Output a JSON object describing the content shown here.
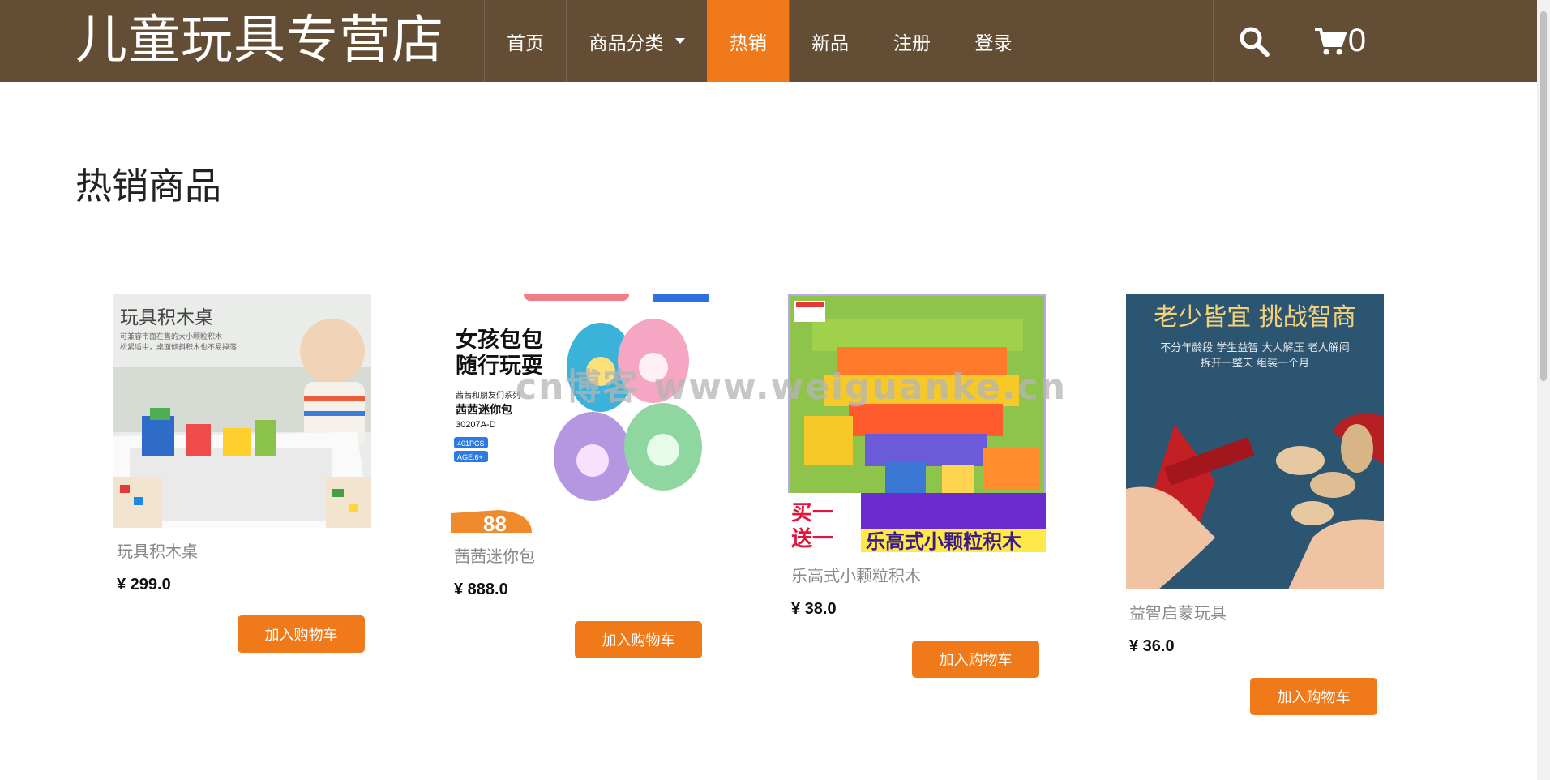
{
  "brand": {
    "title": "儿童玩具专营店"
  },
  "nav": {
    "items": [
      {
        "label": "首页"
      },
      {
        "label": "商品分类"
      },
      {
        "label": "热销"
      },
      {
        "label": "新品"
      },
      {
        "label": "注册"
      },
      {
        "label": "登录"
      }
    ],
    "active_index": 2
  },
  "header_tools": {
    "cart_count": "0",
    "search_icon": "search-icon",
    "cart_icon": "shopping-cart-icon"
  },
  "section": {
    "title": "热销商品"
  },
  "products": [
    {
      "name": "玩具积木桌",
      "price": "¥ 299.0",
      "button": "加入购物车",
      "image_text": {
        "title": "玩具积木桌",
        "line1": "可兼容市面在售的大小颗粒积木",
        "line2": "松紧适中，桌面倾斜积木也不易掉落"
      }
    },
    {
      "name": "茜茜迷你包",
      "price": "¥ 888.0",
      "button": "加入购物车",
      "image_text": {
        "title1": "女孩包包",
        "title2": "随行玩耍",
        "series": "茜茜和朋友们系列",
        "product": "茜茜迷你包",
        "code": "30207A-D",
        "pcs": "401PCS",
        "age": "AGE:6+",
        "badge": "88"
      }
    },
    {
      "name": "乐高式小颗粒积木",
      "price": "¥ 38.0",
      "button": "加入购物车",
      "image_text": {
        "promo1": "买一",
        "promo2": "送一",
        "banner": "乐高式小颗粒积木"
      }
    },
    {
      "name": "益智启蒙玩具",
      "price": "¥ 36.0",
      "button": "加入购物车",
      "image_text": {
        "title": "老少皆宜 挑战智商",
        "line1": "不分年龄段 学生益智 大人解压 老人解闷",
        "line2": "拆开一整天 组装一个月"
      }
    }
  ],
  "watermark": "cn博客 www.weiguanke.cn",
  "colors": {
    "header_bg": "#634d35",
    "accent": "#f07a1a",
    "text_muted": "#888888"
  }
}
